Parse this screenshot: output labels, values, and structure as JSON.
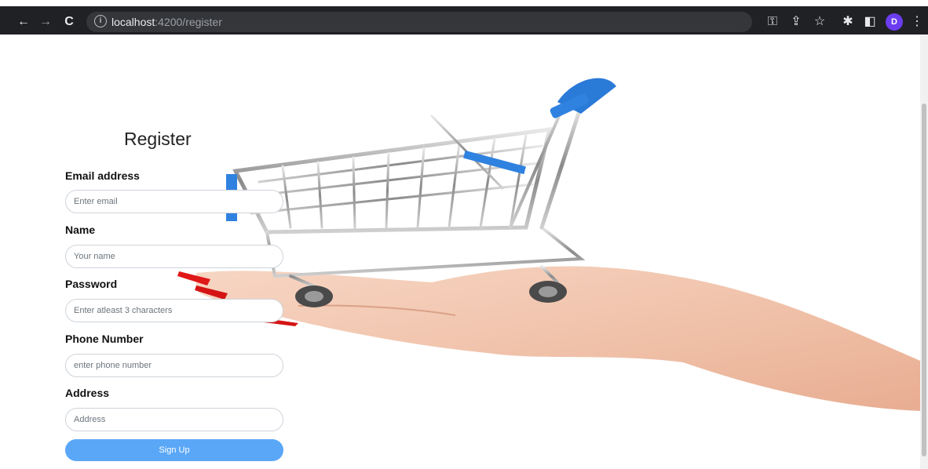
{
  "browser": {
    "url_host": "localhost",
    "url_rest": ":4200/register",
    "profile_initial": "D",
    "nav_back": "←",
    "nav_forward": "→",
    "reload": "C",
    "key_icon": "⚿",
    "share_icon": "⇪",
    "star_icon": "☆",
    "ext_icon": "✱",
    "panel_icon": "◧",
    "menu_icon": "⋮"
  },
  "form": {
    "title": "Register",
    "email": {
      "label": "Email address",
      "placeholder": "Enter email"
    },
    "name": {
      "label": "Name",
      "placeholder": "Your name"
    },
    "password": {
      "label": "Password",
      "placeholder": "Enter atleast 3 characters"
    },
    "phone": {
      "label": "Phone Number",
      "placeholder": "enter phone number"
    },
    "address": {
      "label": "Address",
      "placeholder": "Address"
    },
    "submit_label": "Sign Up"
  },
  "colors": {
    "button": "#5aa7f7",
    "chrome": "#202124",
    "avatar": "#6b3df0"
  }
}
